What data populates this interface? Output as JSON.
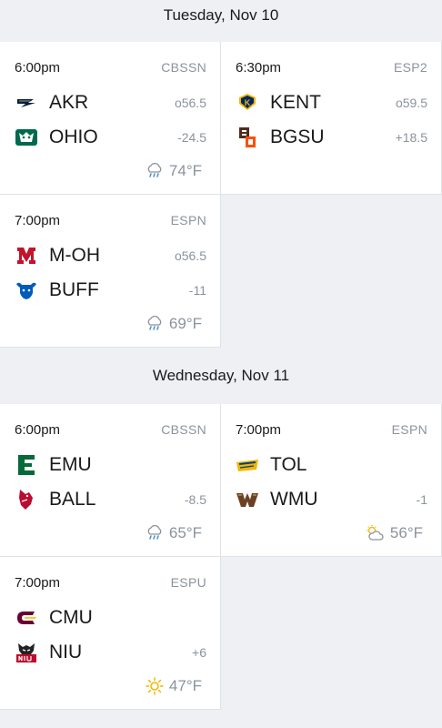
{
  "days": [
    {
      "header": "Tuesday, Nov 10",
      "games": [
        {
          "time": "6:00pm",
          "network": "CBSSN",
          "weather_icon": "rain-icon",
          "temp": "74°F",
          "away": {
            "abbr": "AKR",
            "line": "o56.5",
            "logo": "akron-logo"
          },
          "home": {
            "abbr": "OHIO",
            "line": "-24.5",
            "logo": "ohio-logo"
          }
        },
        {
          "time": "6:30pm",
          "network": "ESP2",
          "weather_icon": "",
          "temp": "",
          "away": {
            "abbr": "KENT",
            "line": "o59.5",
            "logo": "kent-logo"
          },
          "home": {
            "abbr": "BGSU",
            "line": "+18.5",
            "logo": "bgsu-logo"
          }
        },
        {
          "time": "7:00pm",
          "network": "ESPN",
          "weather_icon": "rain-icon",
          "temp": "69°F",
          "away": {
            "abbr": "M-OH",
            "line": "o56.5",
            "logo": "miami-ohio-logo"
          },
          "home": {
            "abbr": "BUFF",
            "line": "-11",
            "logo": "buffalo-logo"
          }
        }
      ]
    },
    {
      "header": "Wednesday, Nov 11",
      "games": [
        {
          "time": "6:00pm",
          "network": "CBSSN",
          "weather_icon": "rain-icon",
          "temp": "65°F",
          "away": {
            "abbr": "EMU",
            "line": "",
            "logo": "emu-logo"
          },
          "home": {
            "abbr": "BALL",
            "line": "-8.5",
            "logo": "ball-state-logo"
          }
        },
        {
          "time": "7:00pm",
          "network": "ESPN",
          "weather_icon": "partly-cloudy-icon",
          "temp": "56°F",
          "away": {
            "abbr": "TOL",
            "line": "",
            "logo": "toledo-logo"
          },
          "home": {
            "abbr": "WMU",
            "line": "-1",
            "logo": "wmu-logo"
          }
        },
        {
          "time": "7:00pm",
          "network": "ESPU",
          "weather_icon": "sun-icon",
          "temp": "47°F",
          "away": {
            "abbr": "CMU",
            "line": "",
            "logo": "cmu-logo"
          },
          "home": {
            "abbr": "NIU",
            "line": "+6",
            "logo": "niu-logo"
          }
        }
      ]
    }
  ],
  "colors": {
    "background": "#eef0f3",
    "card": "#ffffff",
    "muted": "#8b939c",
    "akron": "#041e42",
    "ohio": "#00694e",
    "kent": "#002664",
    "bgsu": "#4f2c1d",
    "miami": "#c3142d",
    "buffalo": "#005bbb",
    "emu": "#046a38",
    "ball": "#ba0c2f",
    "toledo": "#f2b500",
    "wmu": "#6c4023",
    "cmu": "#6a0032",
    "niu": "#ba0c2f",
    "rain": "#4a90c8",
    "sun": "#f5b400"
  }
}
